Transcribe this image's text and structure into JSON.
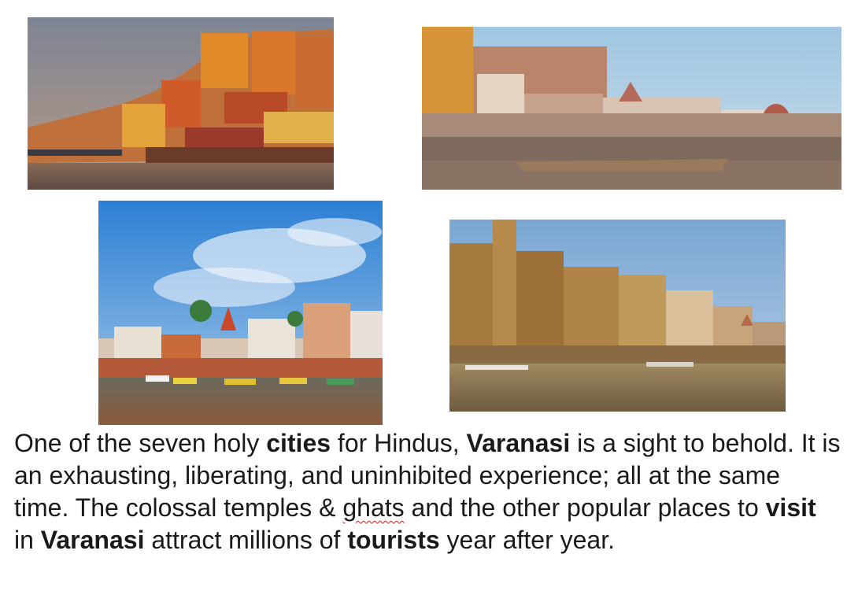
{
  "photos": [
    {
      "id": "p1",
      "subject": "ghats-dusk"
    },
    {
      "id": "p2",
      "subject": "ghats-boat"
    },
    {
      "id": "p3",
      "subject": "ghats-blue-sky"
    },
    {
      "id": "p4",
      "subject": "ghats-palace"
    }
  ],
  "caption": {
    "t1": "One of the seven holy ",
    "b1": "cities",
    "t2": " for Hindus, ",
    "b2": "Varanasi",
    "t3": " is a sight to behold. It is an exhausting, liberating, and uninhibited experience; all at the same time. The colossal temples & ",
    "misspelled": "ghats",
    "t4": " and the other popular places to ",
    "b3": "visit",
    "t5": " in ",
    "b4": "Varanasi",
    "t6": " attract millions of ",
    "b5": "tourists",
    "t7": " year after year."
  },
  "colors": {
    "text": "#1a1a1a",
    "spellcheck_underline": "#d02020"
  }
}
